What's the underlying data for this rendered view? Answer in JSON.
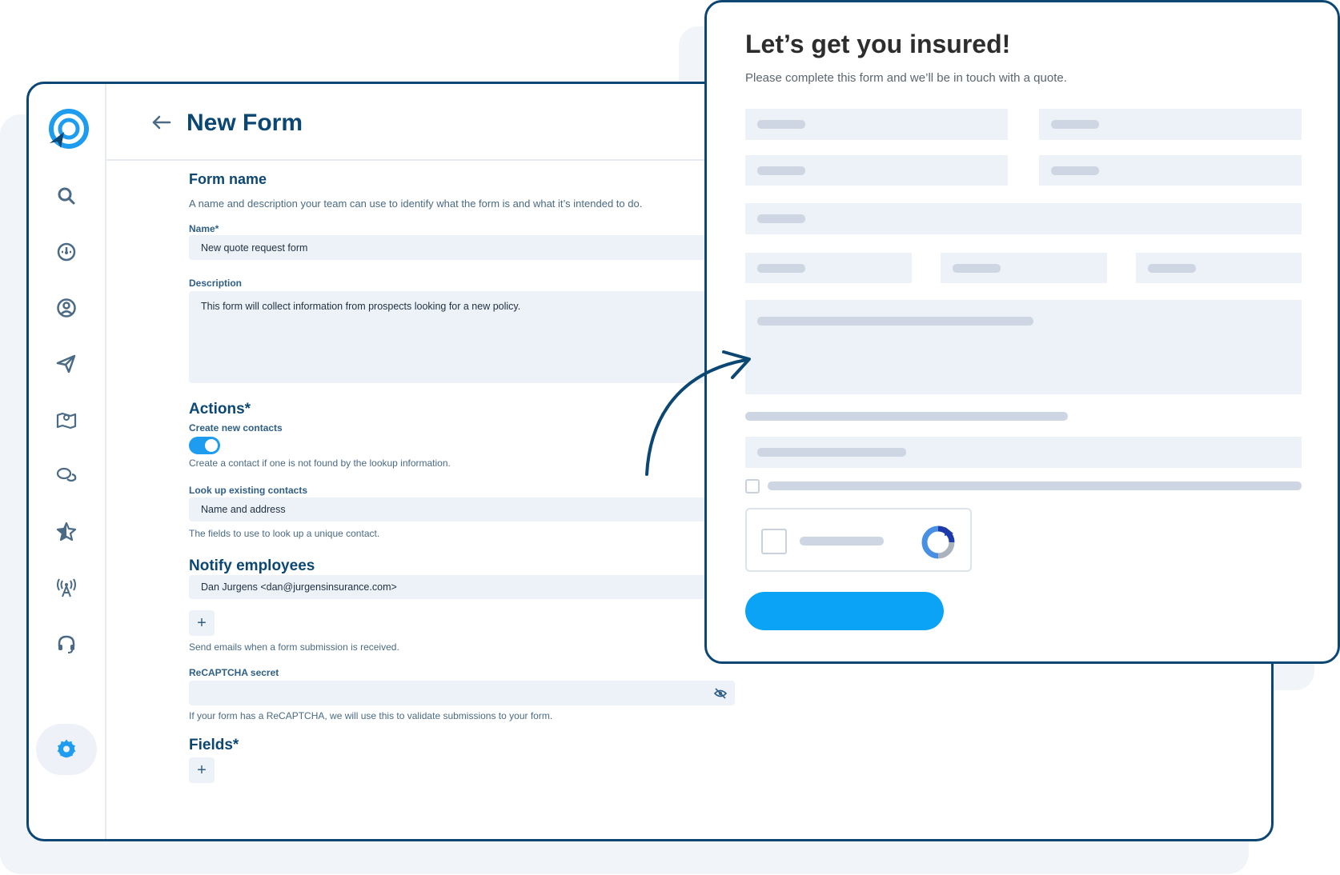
{
  "header": {
    "title": "New Form"
  },
  "form_name": {
    "title": "Form name",
    "helper": "A name and description your team can use to identify what the form is and what it’s intended to do.",
    "name_label": "Name*",
    "name_value": "New quote request form",
    "description_label": "Description",
    "description_value": "This form will collect information from prospects looking for a new policy."
  },
  "actions": {
    "title": "Actions*",
    "create_label": "Create new contacts",
    "create_enabled": true,
    "create_helper": "Create a contact if one is not found by the lookup information.",
    "lookup_label": "Look up existing contacts",
    "lookup_value": "Name and address",
    "lookup_helper": "The fields to use to look up a unique contact."
  },
  "notify": {
    "title": "Notify employees",
    "employee_value": "Dan Jurgens <dan@jurgensinsurance.com>",
    "add_label": "+",
    "helper": "Send emails when a form submission is received."
  },
  "recaptcha": {
    "label": "ReCAPTCHA secret",
    "helper": "If your form has a ReCAPTCHA, we will use this to validate submissions to your form."
  },
  "fields": {
    "title": "Fields*",
    "add_label": "+"
  },
  "modal": {
    "title": "Let’s get you insured!",
    "subtitle": "Please complete this form and we’ll be in touch with a quote."
  },
  "sidebar": {
    "icons": [
      "search-icon",
      "dashboard-gauge-icon",
      "contact-user-icon",
      "send-paper-plane-icon",
      "map-pin-icon",
      "chat-bubbles-icon",
      "star-icon",
      "broadcast-antenna-icon",
      "headset-support-icon",
      "gear-icon"
    ],
    "active": "gear-icon"
  },
  "colors": {
    "navy": "#0c4774",
    "accent": "#1e9cf0",
    "submit": "#0ba3f5",
    "field_bg": "#edf2f9",
    "placeholder_bar": "#cdd6e2"
  }
}
